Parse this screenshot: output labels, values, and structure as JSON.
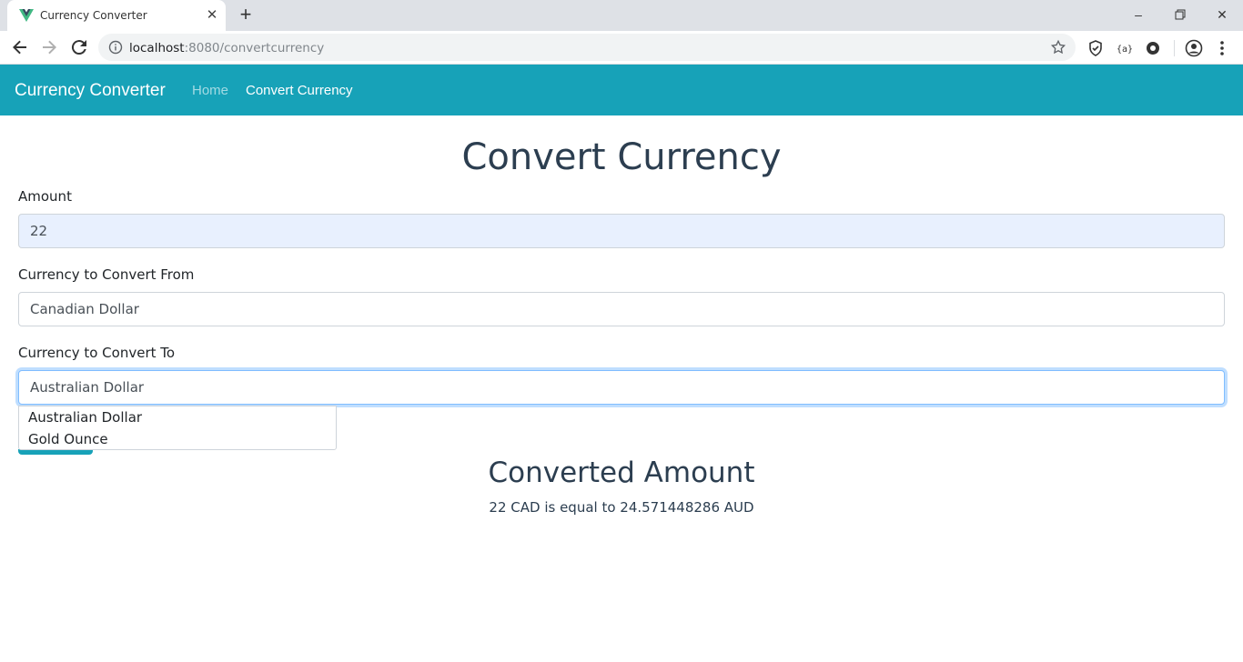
{
  "browser": {
    "tab_title": "Currency Converter",
    "url_host": "localhost",
    "url_rest": ":8080/convertcurrency"
  },
  "navbar": {
    "brand": "Currency Converter",
    "links": [
      "Home",
      "Convert Currency"
    ],
    "color": "#17a2b8"
  },
  "page": {
    "title": "Convert Currency",
    "amount_label": "Amount",
    "amount_value": "22",
    "from_label": "Currency to Convert From",
    "from_value": "Canadian Dollar",
    "to_label": "Currency to Convert To",
    "to_value": "Australian Dollar",
    "suggestions": [
      "Australian Dollar",
      "Gold Ounce"
    ]
  },
  "result": {
    "title": "Converted Amount",
    "text": "22 CAD is equal to 24.571448286 AUD"
  },
  "icons": {
    "favicon": "vue-logo-icon",
    "back": "arrow-left-icon",
    "forward": "arrow-right-icon",
    "reload": "reload-icon",
    "info": "info-icon",
    "star": "star-icon",
    "profile": "profile-icon",
    "menu": "more-vert-icon"
  }
}
